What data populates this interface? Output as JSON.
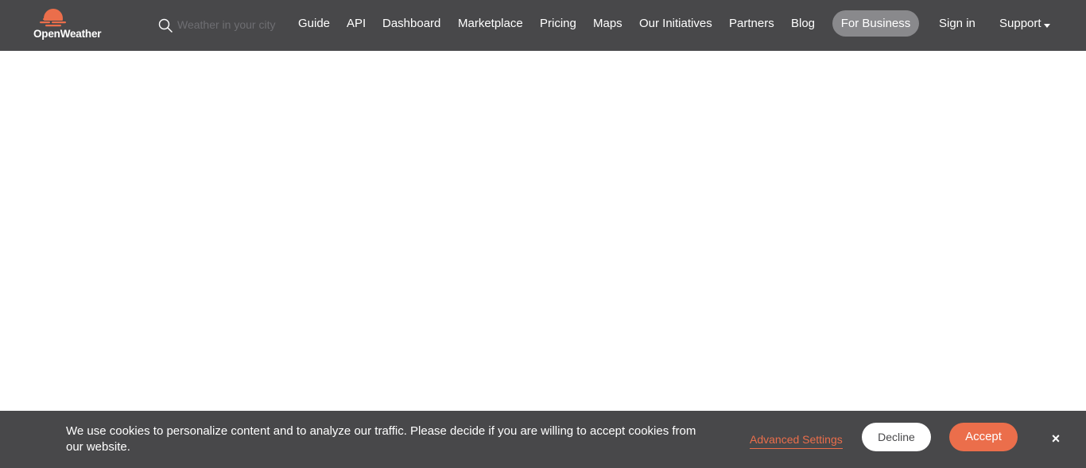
{
  "header": {
    "logo_text": "OpenWeather",
    "search": {
      "placeholder": "Weather in your city",
      "value": ""
    },
    "nav": {
      "guide": "Guide",
      "api": "API",
      "dashboard": "Dashboard",
      "marketplace": "Marketplace",
      "pricing": "Pricing",
      "maps": "Maps",
      "initiatives": "Our Initiatives",
      "partners": "Partners",
      "blog": "Blog",
      "for_business": "For Business",
      "sign_in": "Sign in",
      "support": "Support"
    }
  },
  "cookie_banner": {
    "message": "We use cookies to personalize content and to analyze our traffic. Please decide if you are willing to accept cookies from our website.",
    "advanced_settings": "Advanced Settings",
    "decline": "Decline",
    "accept": "Accept",
    "close": "×"
  },
  "colors": {
    "header_bg": "#48484a",
    "accent": "#eb6e4b",
    "business_btn": "#89898c"
  },
  "icons": {
    "logo": "sun-icon",
    "search": "search-icon",
    "support_caret": "caret-down-icon",
    "close": "close-icon"
  }
}
